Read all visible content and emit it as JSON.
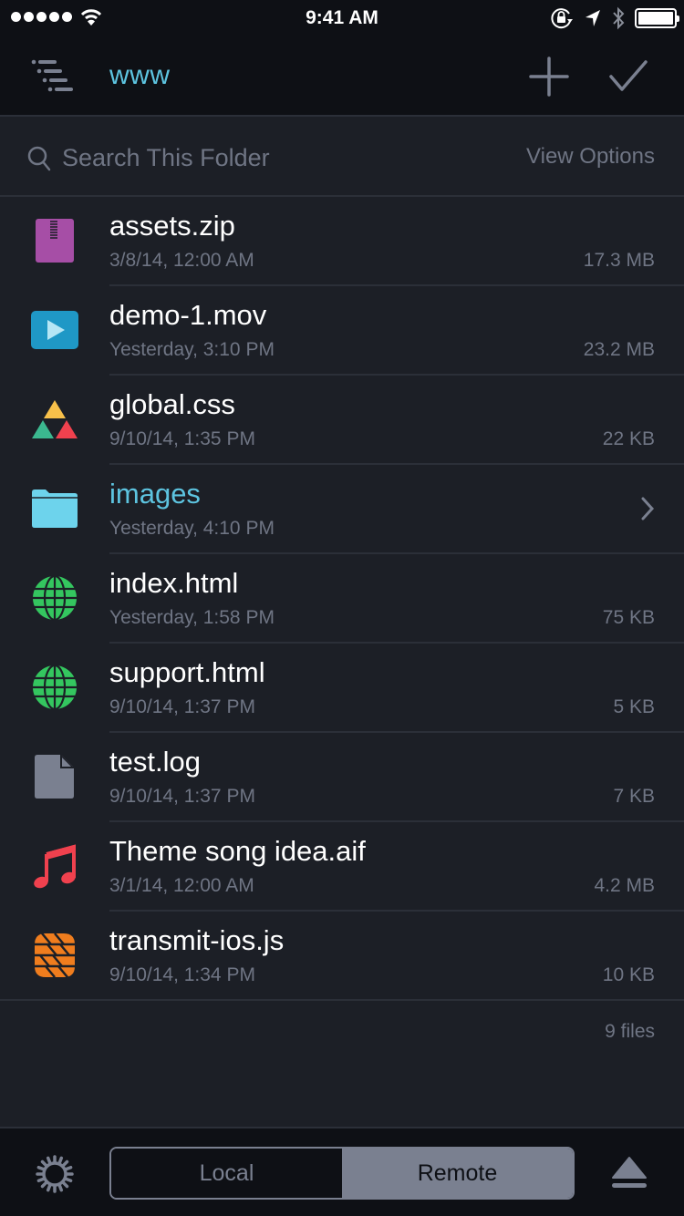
{
  "status_bar": {
    "time": "9:41 AM",
    "signal_bars": 5,
    "battery_percent": 100
  },
  "nav": {
    "title": "www",
    "menu_icon": "outline-list-icon",
    "add_icon": "plus-icon",
    "done_icon": "checkmark-icon"
  },
  "search": {
    "placeholder": "Search This Folder",
    "value": "",
    "view_options_label": "View Options"
  },
  "files": [
    {
      "name": "assets.zip",
      "date": "3/8/14, 12:00 AM",
      "size": "17.3 MB",
      "type": "zip",
      "icon": "zip-archive-icon",
      "color": "#a64ea6"
    },
    {
      "name": "demo-1.mov",
      "date": "Yesterday, 3:10 PM",
      "size": "23.2 MB",
      "type": "video",
      "icon": "video-play-icon",
      "color": "#1f98c6"
    },
    {
      "name": "global.css",
      "date": "9/10/14, 1:35 PM",
      "size": "22 KB",
      "type": "css",
      "icon": "css-triangles-icon",
      "color": "#f7c04a"
    },
    {
      "name": "images",
      "date": "Yesterday, 4:10 PM",
      "size": "",
      "type": "folder",
      "icon": "folder-icon",
      "color": "#6dd3ec"
    },
    {
      "name": "index.html",
      "date": "Yesterday, 1:58 PM",
      "size": "75 KB",
      "type": "html",
      "icon": "globe-icon",
      "color": "#34c65f"
    },
    {
      "name": "support.html",
      "date": "9/10/14, 1:37 PM",
      "size": "5 KB",
      "type": "html",
      "icon": "globe-icon",
      "color": "#34c65f"
    },
    {
      "name": "test.log",
      "date": "9/10/14, 1:37 PM",
      "size": "7 KB",
      "type": "text",
      "icon": "document-icon",
      "color": "#7a8090"
    },
    {
      "name": "Theme song idea.aif",
      "date": "3/1/14, 12:00 AM",
      "size": "4.2 MB",
      "type": "audio",
      "icon": "music-note-icon",
      "color": "#f0414e"
    },
    {
      "name": "transmit-ios.js",
      "date": "9/10/14, 1:34 PM",
      "size": "10 KB",
      "type": "js",
      "icon": "js-script-icon",
      "color": "#ef7d1e"
    }
  ],
  "footer": {
    "file_count": "9 files"
  },
  "bottom_bar": {
    "segments": [
      {
        "label": "Local",
        "selected": false
      },
      {
        "label": "Remote",
        "selected": true
      }
    ],
    "settings_icon": "gear-icon",
    "eject_icon": "eject-icon"
  },
  "colors": {
    "accent": "#5dc4e0",
    "background": "#1c1f26",
    "bar_background": "#0e1015",
    "secondary_text": "#6f7584",
    "divider": "#2b2f38"
  }
}
